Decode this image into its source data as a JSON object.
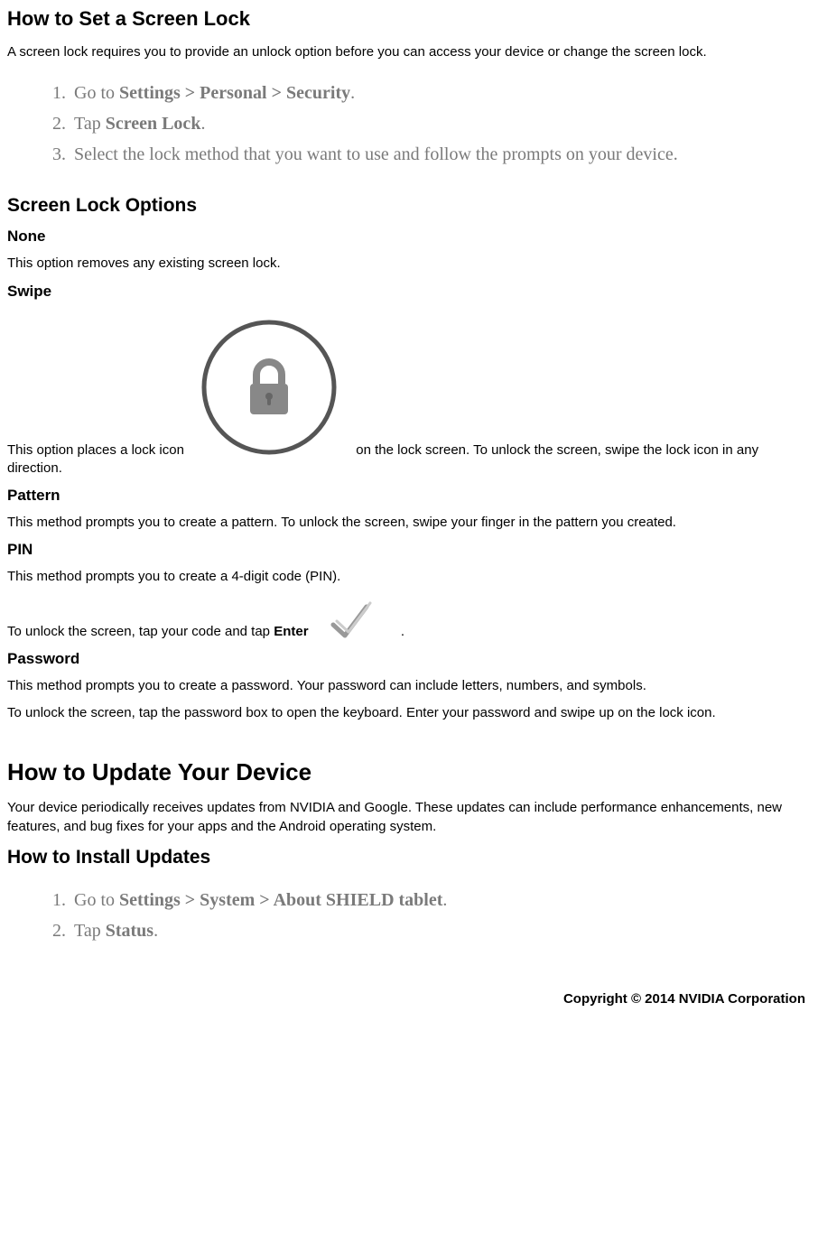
{
  "section1": {
    "title": "How to Set a Screen Lock",
    "intro": "A screen lock requires you to provide an unlock option before you can access your device or change the screen lock.",
    "steps": [
      {
        "pre": "Go to ",
        "bold": "Settings > Personal > Security",
        "post": "."
      },
      {
        "pre": "Tap ",
        "bold": "Screen Lock",
        "post": "."
      },
      {
        "pre": "Select the lock method that you want to use and follow the prompts on your device.",
        "bold": "",
        "post": ""
      }
    ]
  },
  "optionsTitle": "Screen Lock Options",
  "none": {
    "title": "None",
    "desc": "This option removes any existing screen lock."
  },
  "swipe": {
    "title": "Swipe",
    "descPre": "This option places a lock icon",
    "descPost": "on the lock screen. To unlock the screen, swipe the lock icon in any direction."
  },
  "pattern": {
    "title": "Pattern",
    "desc": "This method prompts you to create a pattern. To unlock the screen, swipe your finger in the pattern you created."
  },
  "pin": {
    "title": "PIN",
    "desc1": "This method prompts you to create a 4-digit code (PIN).",
    "desc2Pre": "To unlock the screen, tap your code and tap ",
    "desc2Bold": "Enter",
    "desc2Post": "."
  },
  "password": {
    "title": "Password",
    "desc1": "This method prompts you to create a password. Your password can include letters, numbers, and symbols.",
    "desc2": "To unlock the screen, tap the password box to open the keyboard. Enter your password and swipe up on the lock icon."
  },
  "section2": {
    "title": "How to Update Your Device",
    "intro": "Your device periodically receives updates from NVIDIA and Google. These updates can include performance enhancements, new features, and bug fixes for your apps and the Android operating system.",
    "subTitle": "How to Install Updates",
    "steps": [
      {
        "pre": "Go to ",
        "bold": "Settings > System > About SHIELD tablet",
        "post": "."
      },
      {
        "pre": "Tap ",
        "bold": "Status",
        "post": "."
      }
    ]
  },
  "footer": "Copyright © 2014 NVIDIA Corporation"
}
